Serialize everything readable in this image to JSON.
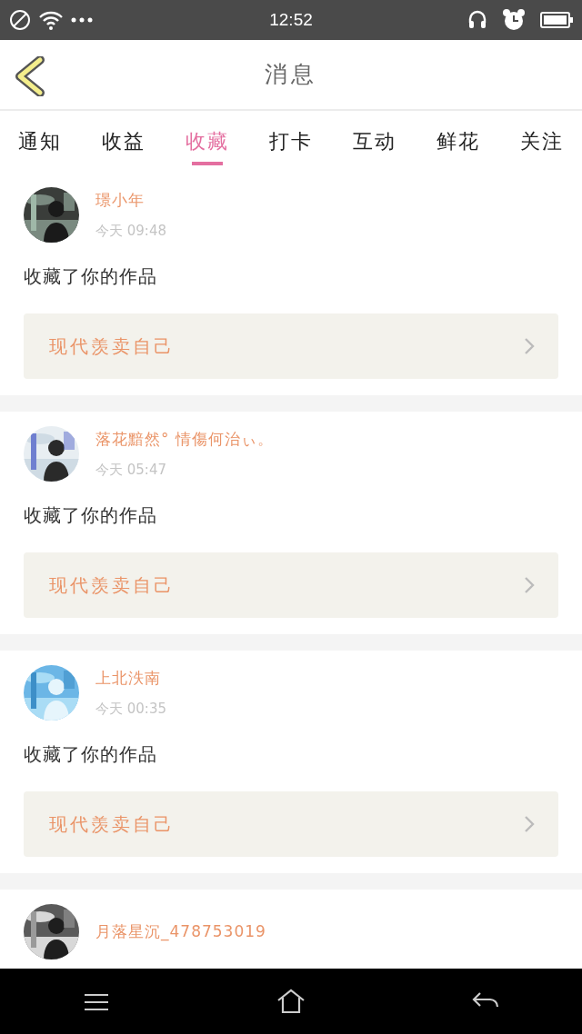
{
  "status_bar": {
    "time": "12:52"
  },
  "header": {
    "title": "消息"
  },
  "tabs": [
    {
      "label": "通知",
      "selected": false
    },
    {
      "label": "收益",
      "selected": false
    },
    {
      "label": "收藏",
      "selected": true
    },
    {
      "label": "打卡",
      "selected": false
    },
    {
      "label": "互动",
      "selected": false
    },
    {
      "label": "鲜花",
      "selected": false
    },
    {
      "label": "关注",
      "selected": false
    }
  ],
  "messages": [
    {
      "name": "璟小年",
      "time": "今天 09:48",
      "action": "收藏了你的作品",
      "work": "现代羡卖自己"
    },
    {
      "name": "落花黯然° 情傷何治ぃ。",
      "time": "今天 05:47",
      "action": "收藏了你的作品",
      "work": "现代羡卖自己"
    },
    {
      "name": "上北泆南",
      "time": "今天 00:35",
      "action": "收藏了你的作品",
      "work": "现代羡卖自己"
    },
    {
      "name": "月落星沉_478753019"
    }
  ]
}
